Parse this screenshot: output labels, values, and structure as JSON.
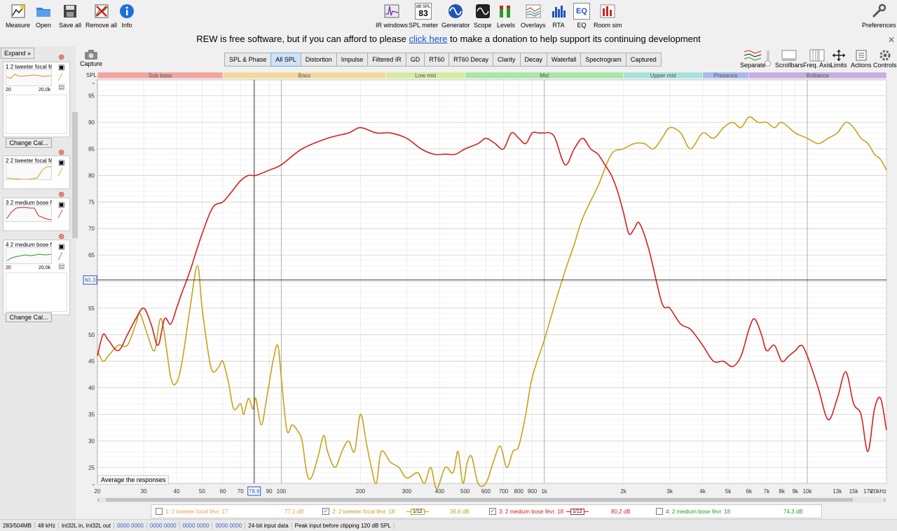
{
  "toolbar": {
    "left": [
      {
        "label": "Measure",
        "icon": "measure-icon"
      },
      {
        "label": "Open",
        "icon": "open-folder-icon"
      },
      {
        "label": "Save all",
        "icon": "save-icon"
      },
      {
        "label": "Remove all",
        "icon": "remove-all-icon"
      },
      {
        "label": "Info",
        "icon": "info-icon"
      }
    ],
    "center": [
      {
        "label": "IR windows",
        "icon": "ir-windows-icon"
      },
      {
        "label": "SPL meter",
        "icon": "spl-meter-icon",
        "badge_top": "dB SPL",
        "badge_value": "83"
      },
      {
        "label": "Generator",
        "icon": "generator-icon"
      },
      {
        "label": "Scope",
        "icon": "scope-icon"
      },
      {
        "label": "Levels",
        "icon": "levels-icon"
      },
      {
        "label": "Overlays",
        "icon": "overlays-icon"
      },
      {
        "label": "RTA",
        "icon": "rta-icon"
      },
      {
        "label": "EQ",
        "icon": "eq-icon"
      },
      {
        "label": "Room sim",
        "icon": "room-sim-icon"
      }
    ],
    "right": {
      "label": "Preferences",
      "icon": "preferences-icon"
    }
  },
  "donate": {
    "before": "REW is free software, but if you can afford to please ",
    "link": "click here",
    "after": " to make a donation to help support its continuing development"
  },
  "sidebar": {
    "expand": "Expand",
    "change_cal": "Change Cal...",
    "measurements": [
      {
        "num": "1",
        "title": "2 tweeter focal fé",
        "x_min": "20",
        "x_max": "20,0k",
        "color": "#d98c1f"
      },
      {
        "num": "2",
        "title": "2 tweeter focal fé",
        "x_min": "20",
        "x_max": "20,0k",
        "color": "#c8a21a"
      },
      {
        "num": "3",
        "title": "2 medium bose f",
        "x_min": "20",
        "x_max": "20,0k",
        "color": "#d42020"
      },
      {
        "num": "4",
        "title": "2 medium bose f",
        "x_min": "20",
        "x_max": "20,0k",
        "color": "#2a9a2a"
      }
    ]
  },
  "capture": {
    "label": "Capture",
    "icon": "camera-icon"
  },
  "tabs": [
    "SPL & Phase",
    "All SPL",
    "Distortion",
    "Impulse",
    "Filtered IR",
    "GD",
    "RT60",
    "RT60 Decay",
    "Clarity",
    "Decay",
    "Waterfall",
    "Spectrogram",
    "Captured"
  ],
  "active_tab": "All SPL",
  "graph_controls": [
    {
      "label": "Separate",
      "icon": "separate-icon"
    },
    {
      "label": "Scrollbars",
      "icon": "scrollbars-icon"
    },
    {
      "label": "Freq. Axis",
      "icon": "freq-axis-icon"
    },
    {
      "label": "Limits",
      "icon": "limits-icon"
    },
    {
      "label": "Actions",
      "icon": "actions-icon"
    },
    {
      "label": "Controls",
      "icon": "controls-icon"
    }
  ],
  "bands": [
    {
      "name": "Sub bass",
      "from": 20,
      "to": 60,
      "color": "#f4a3a3"
    },
    {
      "name": "Bass",
      "from": 60,
      "to": 250,
      "color": "#f4d89a"
    },
    {
      "name": "Low mid",
      "from": 250,
      "to": 500,
      "color": "#d4ec9c"
    },
    {
      "name": "Mid",
      "from": 500,
      "to": 2000,
      "color": "#a9e6a9"
    },
    {
      "name": "Upper mid",
      "from": 2000,
      "to": 4000,
      "color": "#a6e2d9"
    },
    {
      "name": "Presence",
      "from": 4000,
      "to": 6000,
      "color": "#a9b9ec"
    },
    {
      "name": "Brilliance",
      "from": 6000,
      "to": 20000,
      "color": "#c7aee2"
    }
  ],
  "average_button": "Average the responses",
  "chart_data": {
    "type": "line",
    "xlabel": "",
    "ylabel": "SPL",
    "x_scale": "log",
    "xlim": [
      20,
      20000
    ],
    "ylim": [
      22,
      98
    ],
    "grid": true,
    "cursor": {
      "x_label": "78,9",
      "y_label": "60,3",
      "x": 78.9,
      "y": 60.3
    },
    "x_ticks": [
      {
        "v": 20,
        "t": "20"
      },
      {
        "v": 30,
        "t": "30"
      },
      {
        "v": 40,
        "t": "40"
      },
      {
        "v": 50,
        "t": "50"
      },
      {
        "v": 60,
        "t": "60"
      },
      {
        "v": 70,
        "t": "70"
      },
      {
        "v": 90,
        "t": "90"
      },
      {
        "v": 100,
        "t": "100"
      },
      {
        "v": 200,
        "t": "200"
      },
      {
        "v": 300,
        "t": "300"
      },
      {
        "v": 400,
        "t": "400"
      },
      {
        "v": 500,
        "t": "500"
      },
      {
        "v": 600,
        "t": "600"
      },
      {
        "v": 700,
        "t": "700"
      },
      {
        "v": 800,
        "t": "800"
      },
      {
        "v": 900,
        "t": "900"
      },
      {
        "v": 1000,
        "t": "1k"
      },
      {
        "v": 2000,
        "t": "2k"
      },
      {
        "v": 3000,
        "t": "3k"
      },
      {
        "v": 4000,
        "t": "4k"
      },
      {
        "v": 5000,
        "t": "5k"
      },
      {
        "v": 6000,
        "t": "6k"
      },
      {
        "v": 7000,
        "t": "7k"
      },
      {
        "v": 8000,
        "t": "8k"
      },
      {
        "v": 9000,
        "t": "9k"
      },
      {
        "v": 10000,
        "t": "10k"
      },
      {
        "v": 13000,
        "t": "13k"
      },
      {
        "v": 15000,
        "t": "15k"
      },
      {
        "v": 17000,
        "t": "17k"
      },
      {
        "v": 20000,
        "t": "20kHz"
      }
    ],
    "y_ticks": [
      25,
      30,
      35,
      40,
      45,
      50,
      55,
      65,
      70,
      75,
      80,
      85,
      90,
      95
    ],
    "series": [
      {
        "color": "#c8a21a",
        "points": [
          [
            20,
            47
          ],
          [
            21,
            45
          ],
          [
            22,
            46
          ],
          [
            24,
            48
          ],
          [
            26,
            48
          ],
          [
            28,
            52
          ],
          [
            29,
            54
          ],
          [
            31,
            50
          ],
          [
            33,
            47
          ],
          [
            35,
            53
          ],
          [
            38,
            42
          ],
          [
            40,
            41
          ],
          [
            42,
            45
          ],
          [
            45,
            55
          ],
          [
            48,
            63
          ],
          [
            50,
            55
          ],
          [
            53,
            46
          ],
          [
            55,
            43
          ],
          [
            58,
            44
          ],
          [
            60,
            45
          ],
          [
            63,
            41
          ],
          [
            66,
            36
          ],
          [
            70,
            37
          ],
          [
            72,
            35
          ],
          [
            75,
            38
          ],
          [
            78,
            36
          ],
          [
            80,
            38
          ],
          [
            84,
            33
          ],
          [
            88,
            38
          ],
          [
            93,
            45
          ],
          [
            97,
            48
          ],
          [
            100,
            42
          ],
          [
            105,
            32
          ],
          [
            110,
            33
          ],
          [
            115,
            32
          ],
          [
            120,
            30
          ],
          [
            125,
            24
          ],
          [
            130,
            23
          ],
          [
            138,
            27
          ],
          [
            145,
            31
          ],
          [
            150,
            28
          ],
          [
            160,
            25
          ],
          [
            170,
            28
          ],
          [
            180,
            30
          ],
          [
            190,
            28
          ],
          [
            200,
            35
          ],
          [
            210,
            30
          ],
          [
            220,
            25
          ],
          [
            230,
            22
          ],
          [
            240,
            28
          ],
          [
            260,
            26
          ],
          [
            280,
            25
          ],
          [
            300,
            23
          ],
          [
            330,
            24
          ],
          [
            350,
            22
          ],
          [
            370,
            25
          ],
          [
            390,
            21
          ],
          [
            420,
            25
          ],
          [
            450,
            24
          ],
          [
            470,
            28
          ],
          [
            490,
            22
          ],
          [
            510,
            26
          ],
          [
            530,
            27
          ],
          [
            560,
            22
          ],
          [
            600,
            22
          ],
          [
            640,
            26
          ],
          [
            680,
            29
          ],
          [
            720,
            25
          ],
          [
            760,
            28
          ],
          [
            800,
            29
          ],
          [
            850,
            35
          ],
          [
            900,
            42
          ],
          [
            1000,
            49
          ],
          [
            1100,
            56
          ],
          [
            1200,
            62
          ],
          [
            1300,
            67
          ],
          [
            1400,
            72
          ],
          [
            1600,
            78
          ],
          [
            1800,
            84
          ],
          [
            2000,
            85
          ],
          [
            2200,
            86
          ],
          [
            2400,
            86
          ],
          [
            2600,
            85
          ],
          [
            2800,
            87
          ],
          [
            3000,
            89
          ],
          [
            3300,
            88
          ],
          [
            3600,
            85
          ],
          [
            4000,
            88
          ],
          [
            4400,
            87
          ],
          [
            4800,
            89
          ],
          [
            5200,
            90
          ],
          [
            5600,
            89
          ],
          [
            6000,
            91
          ],
          [
            6500,
            90
          ],
          [
            7000,
            90
          ],
          [
            7500,
            89
          ],
          [
            8000,
            90
          ],
          [
            9000,
            88
          ],
          [
            10000,
            87
          ],
          [
            11000,
            86
          ],
          [
            12000,
            87
          ],
          [
            13000,
            88
          ],
          [
            14000,
            90
          ],
          [
            15000,
            89
          ],
          [
            16000,
            87
          ],
          [
            17000,
            86
          ],
          [
            18000,
            84
          ],
          [
            19000,
            83
          ],
          [
            20000,
            81
          ]
        ]
      },
      {
        "color": "#d42020",
        "points": [
          [
            20,
            46
          ],
          [
            21,
            50
          ],
          [
            22,
            49
          ],
          [
            24,
            47
          ],
          [
            26,
            50
          ],
          [
            28,
            53
          ],
          [
            30,
            55
          ],
          [
            32,
            52
          ],
          [
            34,
            48
          ],
          [
            36,
            53
          ],
          [
            38,
            52
          ],
          [
            40,
            55
          ],
          [
            42,
            58
          ],
          [
            45,
            62
          ],
          [
            50,
            69
          ],
          [
            55,
            74
          ],
          [
            60,
            75
          ],
          [
            65,
            77
          ],
          [
            70,
            79
          ],
          [
            75,
            80
          ],
          [
            80,
            80
          ],
          [
            90,
            81
          ],
          [
            100,
            82
          ],
          [
            120,
            85
          ],
          [
            150,
            87
          ],
          [
            180,
            88
          ],
          [
            200,
            89
          ],
          [
            230,
            88
          ],
          [
            260,
            88
          ],
          [
            300,
            87
          ],
          [
            340,
            85
          ],
          [
            380,
            84
          ],
          [
            420,
            84
          ],
          [
            460,
            84
          ],
          [
            500,
            85
          ],
          [
            560,
            86
          ],
          [
            600,
            87
          ],
          [
            650,
            86
          ],
          [
            700,
            85
          ],
          [
            750,
            88
          ],
          [
            800,
            87
          ],
          [
            850,
            86
          ],
          [
            900,
            88
          ],
          [
            950,
            88
          ],
          [
            1000,
            88
          ],
          [
            1050,
            88
          ],
          [
            1100,
            87
          ],
          [
            1200,
            82
          ],
          [
            1300,
            85
          ],
          [
            1400,
            87
          ],
          [
            1500,
            85
          ],
          [
            1600,
            84
          ],
          [
            1700,
            82
          ],
          [
            1800,
            80
          ],
          [
            1900,
            77
          ],
          [
            2000,
            73
          ],
          [
            2100,
            69
          ],
          [
            2200,
            70
          ],
          [
            2300,
            71
          ],
          [
            2500,
            66
          ],
          [
            2800,
            56
          ],
          [
            3000,
            55
          ],
          [
            3300,
            52
          ],
          [
            3600,
            51
          ],
          [
            4000,
            48
          ],
          [
            4400,
            45
          ],
          [
            4800,
            45
          ],
          [
            5200,
            44
          ],
          [
            5600,
            46
          ],
          [
            6000,
            51
          ],
          [
            6300,
            53
          ],
          [
            6700,
            50
          ],
          [
            7000,
            47
          ],
          [
            7500,
            48
          ],
          [
            8000,
            45
          ],
          [
            8500,
            46
          ],
          [
            9000,
            47
          ],
          [
            9500,
            48
          ],
          [
            10000,
            46
          ],
          [
            11000,
            40
          ],
          [
            12000,
            34
          ],
          [
            13000,
            38
          ],
          [
            14000,
            43
          ],
          [
            15000,
            37
          ],
          [
            16000,
            35
          ],
          [
            17000,
            28
          ],
          [
            18000,
            36
          ],
          [
            19000,
            38
          ],
          [
            20000,
            32
          ]
        ]
      }
    ]
  },
  "legend": [
    {
      "checked": false,
      "name": "1: 2 tweeter focal févr. 17",
      "value": "77,1 dB",
      "color": "#e8a24d",
      "show_smooth": false
    },
    {
      "checked": true,
      "name": "2: 2 tweeter focal févr. 18",
      "value": "36,6 dB",
      "color": "#c8a21a",
      "show_smooth": true,
      "smooth": "1/12"
    },
    {
      "checked": true,
      "name": "3: 2 medium bose févr. 18",
      "value": "80,2 dB",
      "color": "#d42020",
      "show_smooth": true,
      "smooth": "1/12"
    },
    {
      "checked": false,
      "name": "4: 2 medium bose févr. 18",
      "value": "74,3 dB",
      "color": "#2a9a2a",
      "show_smooth": false
    }
  ],
  "status": {
    "memory": "283/504MB",
    "rate": "48 kHz",
    "io": "Int32L in, Int32L out",
    "bits1": "0000 0000",
    "bits2": "0000 0000",
    "bits3": "0000 0000",
    "bits4": "0000 0000",
    "format": "24-bit input data",
    "peak": "Peak input before clipping 120 dB SPL"
  }
}
